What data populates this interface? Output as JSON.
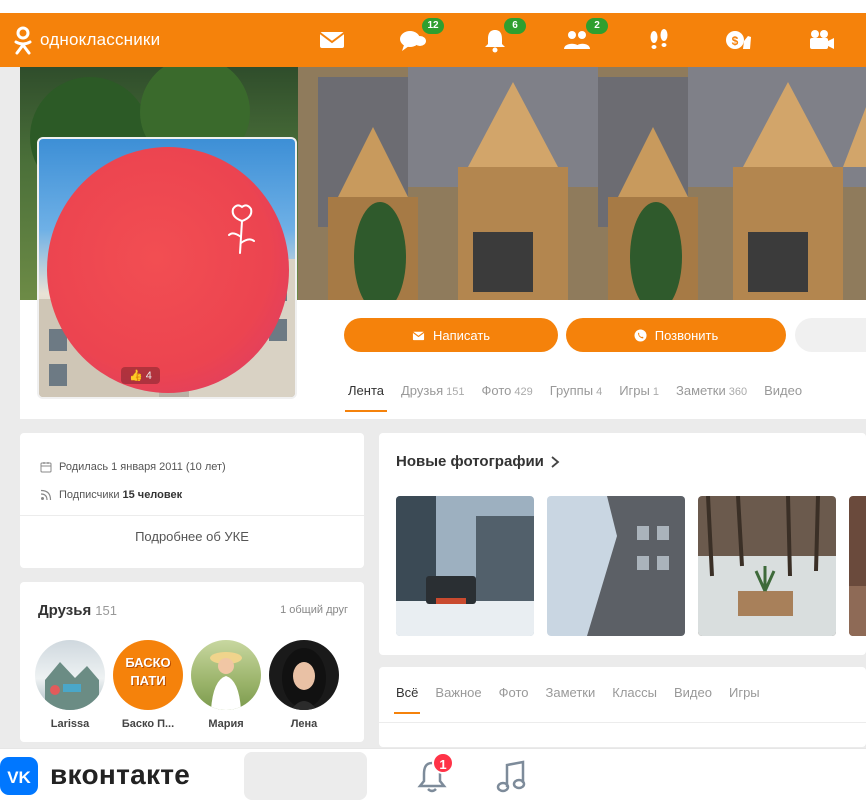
{
  "brand": {
    "ok_name": "одноклассники",
    "ok_color": "#f5820b",
    "vk_name": "вконтакте",
    "vk_color": "#0077ff"
  },
  "topnav": {
    "items": [
      {
        "icon": "mail-icon",
        "badge": ""
      },
      {
        "icon": "chat-icon",
        "badge": "12"
      },
      {
        "icon": "bell-icon",
        "badge": "6"
      },
      {
        "icon": "friends-icon",
        "badge": "2"
      },
      {
        "icon": "footprints-icon",
        "badge": ""
      },
      {
        "icon": "money-like-icon",
        "badge": ""
      },
      {
        "icon": "video-camera-icon",
        "badge": ""
      }
    ]
  },
  "profile": {
    "avatar_likes": "4",
    "buttons": {
      "write": "Написать",
      "call": "Позвонить"
    },
    "tabs": [
      {
        "label": "Лента",
        "count": ""
      },
      {
        "label": "Друзья",
        "count": "151"
      },
      {
        "label": "Фото",
        "count": "429"
      },
      {
        "label": "Группы",
        "count": "4"
      },
      {
        "label": "Игры",
        "count": "1"
      },
      {
        "label": "Заметки",
        "count": "360"
      },
      {
        "label": "Видео",
        "count": ""
      }
    ]
  },
  "info": {
    "birth": "Родилась 1 января 2011 (10 лет)",
    "subscribers_label": "Подписчики",
    "subscribers_value": "15 человек",
    "more_link": "Подробнее об УКЕ"
  },
  "friends": {
    "title": "Друзья",
    "count": "151",
    "common": "1 общий друг",
    "items": [
      {
        "name": "Larissa"
      },
      {
        "name": "Баско П..."
      },
      {
        "name": "Мария"
      },
      {
        "name": "Лена"
      }
    ],
    "basko_avatar_text": "БАСКО ПАТИ"
  },
  "photos": {
    "title": "Новые фотографии"
  },
  "feed": {
    "tabs": [
      "Всё",
      "Важное",
      "Фото",
      "Заметки",
      "Классы",
      "Видео",
      "Игры"
    ]
  },
  "vk": {
    "notifications_badge": "1"
  }
}
